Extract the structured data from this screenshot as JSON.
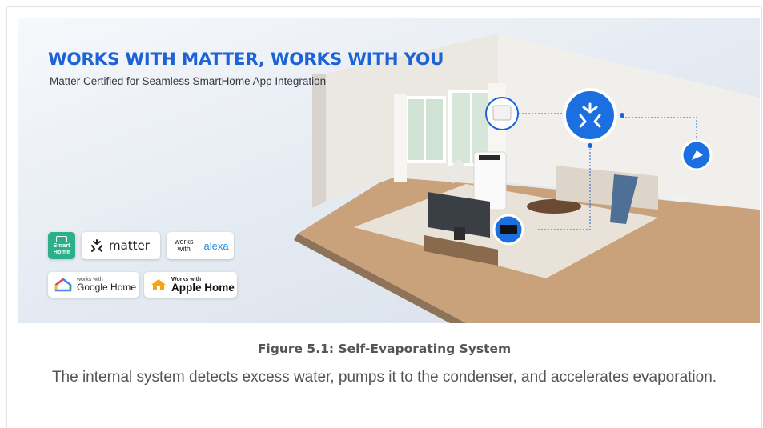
{
  "banner": {
    "headline": "WORKS WITH MATTER, WORKS WITH YOU",
    "subline": "Matter Certified for Seamless SmartHome App Integration",
    "accent_color": "#1c63d8",
    "hub_icon": "matter-logo-icon",
    "badges": {
      "smart_home": [
        "Smart",
        "Home"
      ],
      "matter": "matter",
      "alexa_works": [
        "works",
        "with"
      ],
      "alexa": "alexa",
      "google_small": "works with",
      "google_big": "Google Home",
      "apple_small": "Works with",
      "apple_big": "Apple Home"
    }
  },
  "figure": {
    "caption": "Figure 5.1: Self-Evaporating System",
    "description": "The internal system detects excess water, pumps it to the condenser, and accelerates evaporation."
  }
}
